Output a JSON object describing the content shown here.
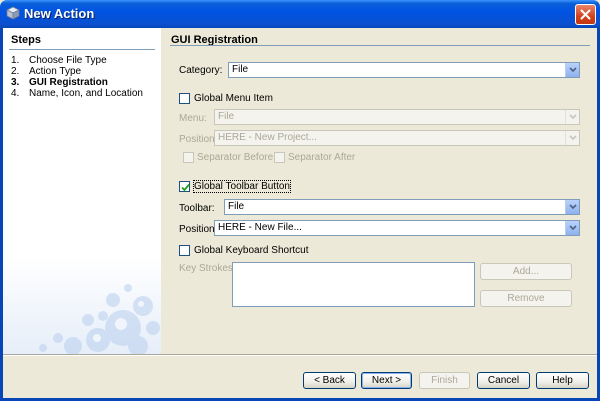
{
  "window": {
    "title": "New Action",
    "icon": "cube-icon",
    "close_icon": "close-icon"
  },
  "steps": {
    "heading": "Steps",
    "items": [
      {
        "num": "1.",
        "label": "Choose File Type"
      },
      {
        "num": "2.",
        "label": "Action Type"
      },
      {
        "num": "3.",
        "label": "GUI Registration"
      },
      {
        "num": "4.",
        "label": "Name, Icon, and Location"
      }
    ]
  },
  "main": {
    "heading": "GUI Registration",
    "category": {
      "label": "Category:",
      "value": "File"
    },
    "global_menu": {
      "checkbox_label": "Global Menu Item",
      "checked": false,
      "menu_label": "Menu:",
      "menu_value": "File",
      "position_label": "Position:",
      "position_value": "HERE - New Project...",
      "sep_before": "Separator Before",
      "sep_after": "Separator After"
    },
    "global_toolbar": {
      "checkbox_label": "Global Toolbar Button",
      "checked": true,
      "toolbar_label": "Toolbar:",
      "toolbar_value": "File",
      "position_label": "Position:",
      "position_value": "HERE - New File..."
    },
    "keyboard": {
      "checkbox_label": "Global Keyboard Shortcut",
      "checked": false,
      "keystrokes_label": "Key Strokes:",
      "add_label": "Add...",
      "remove_label": "Remove"
    }
  },
  "footer": {
    "back": "< Back",
    "next": "Next >",
    "finish": "Finish",
    "cancel": "Cancel",
    "help": "Help"
  }
}
